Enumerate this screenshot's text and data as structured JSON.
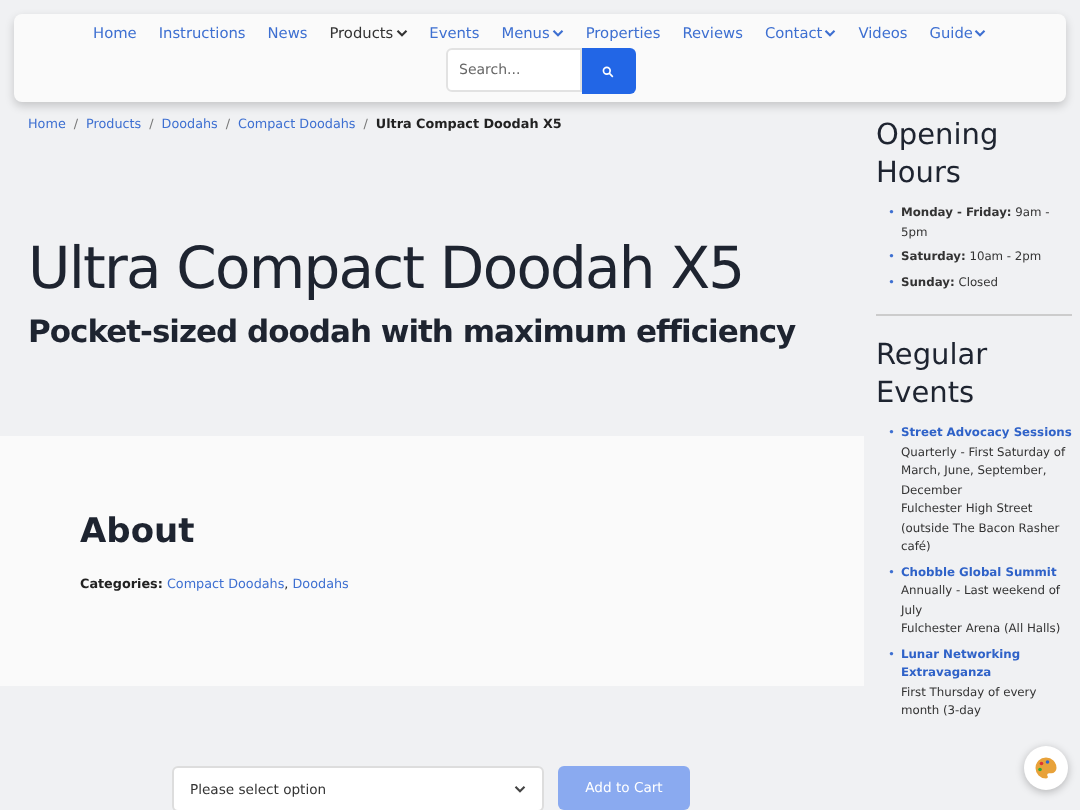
{
  "nav": {
    "items": [
      {
        "label": "Home",
        "dropdown": false,
        "selected": false
      },
      {
        "label": "Instructions",
        "dropdown": false,
        "selected": false
      },
      {
        "label": "News",
        "dropdown": false,
        "selected": false
      },
      {
        "label": "Products",
        "dropdown": true,
        "selected": true
      },
      {
        "label": "Events",
        "dropdown": false,
        "selected": false
      },
      {
        "label": "Menus",
        "dropdown": true,
        "selected": false
      },
      {
        "label": "Properties",
        "dropdown": false,
        "selected": false
      },
      {
        "label": "Reviews",
        "dropdown": false,
        "selected": false
      },
      {
        "label": "Contact",
        "dropdown": true,
        "selected": false
      },
      {
        "label": "Videos",
        "dropdown": false,
        "selected": false
      },
      {
        "label": "Guide",
        "dropdown": true,
        "selected": false
      }
    ],
    "search": {
      "placeholder": "Search..."
    }
  },
  "breadcrumb": {
    "separator": "/",
    "items": [
      "Home",
      "Products",
      "Doodahs",
      "Compact Doodahs",
      "Ultra Compact Doodah X5"
    ]
  },
  "bullet": "•",
  "hero": {
    "title": "Ultra Compact Doodah X5",
    "subtitle": "Pocket-sized doodah with maximum efficiency"
  },
  "about": {
    "heading": "About",
    "categories_label": "Categories:",
    "categories": [
      "Compact Doodahs",
      "Doodahs"
    ],
    "separator": ","
  },
  "purchase": {
    "select": "Please select option",
    "button": "Add to Cart",
    "disabled": true
  },
  "sidebar": {
    "hours_title": "Opening Hours",
    "hours": [
      {
        "day": "Monday - Friday:",
        "time": "9am - 5pm"
      },
      {
        "day": "Saturday:",
        "time": "10am - 2pm"
      },
      {
        "day": "Sunday:",
        "time": "Closed"
      }
    ],
    "events_title": "Regular Events",
    "events": [
      {
        "name": "Street Advocacy Sessions",
        "lines": [
          "Quarterly - First Saturday of March, June, September, December",
          "Fulchester High Street (outside The Bacon Rasher café)"
        ]
      },
      {
        "name": "Chobble Global Summit",
        "lines": [
          "Annually - Last weekend of July",
          "Fulchester Arena (All Halls)"
        ]
      },
      {
        "name": "Lunar Networking Extravaganza",
        "lines": [
          "First Thursday of every month (3-day"
        ]
      }
    ]
  }
}
